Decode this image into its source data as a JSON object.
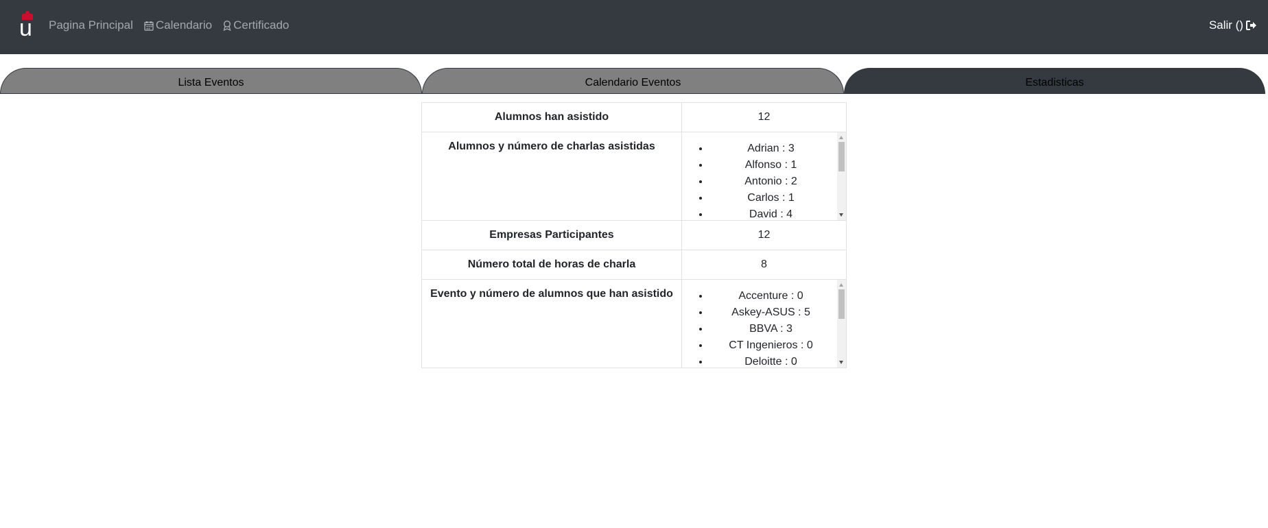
{
  "nav": {
    "logo_text": "u",
    "links": [
      "Pagina Principal",
      "Calendario",
      "Certificado"
    ],
    "logout": "Salir ()"
  },
  "tabs": [
    "Lista Eventos",
    "Calendario Eventos",
    "Estadisticas"
  ],
  "active_tab": "Estadisticas",
  "stats": {
    "alumnos_label": "Alumnos han asistido",
    "alumnos_value": "12",
    "charlas_label": "Alumnos y número de charlas asistidas",
    "charlas_items": [
      "Adrian : 3",
      "Alfonso : 1",
      "Antonio : 2",
      "Carlos : 1",
      "David : 4"
    ],
    "empresas_label": "Empresas Participantes",
    "empresas_value": "12",
    "horas_label": "Número total de horas de charla",
    "horas_value": "8",
    "evento_label": "Evento y número de alumnos que han asistido",
    "evento_items": [
      "Accenture : 0",
      "Askey-ASUS : 5",
      "BBVA : 3",
      "CT Ingenieros : 0",
      "Deloitte : 0"
    ]
  },
  "colors": {
    "navbar": "#343a40",
    "tab_inactive": "#808080",
    "tab_active": "#343a40",
    "logo_crown": "#c8102e"
  }
}
